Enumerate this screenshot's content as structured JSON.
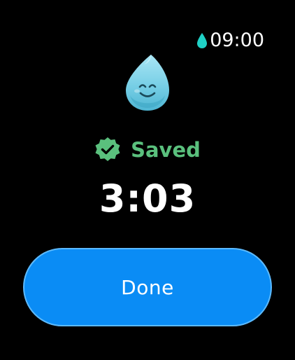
{
  "status_bar": {
    "time": "09:00",
    "icon": "water-drop-icon",
    "icon_color": "#1fd1c6"
  },
  "mascot": {
    "icon": "smiling-water-drop-icon",
    "color": "#7dd3e8"
  },
  "status": {
    "label": "Saved",
    "icon": "check-badge-icon",
    "color": "#5ac07d"
  },
  "timer": {
    "value": "3:03"
  },
  "actions": {
    "done_label": "Done",
    "done_color": "#0a8cf5"
  }
}
